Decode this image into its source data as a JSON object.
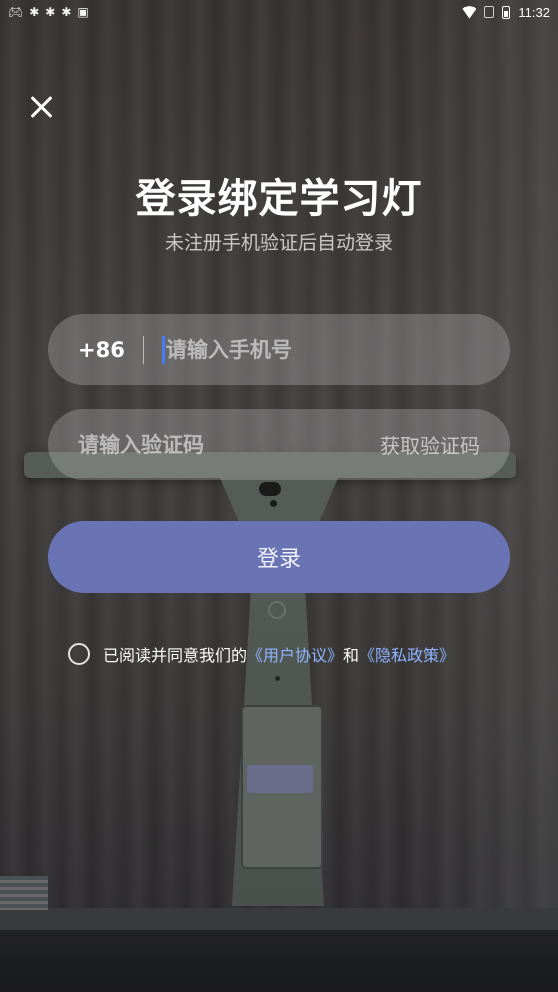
{
  "status_bar": {
    "time": "11:32",
    "left_icons": [
      "gamepad-icon",
      "bug-icon",
      "bug-icon",
      "bug-icon",
      "notification-icon"
    ],
    "right_icons": [
      "wifi-icon",
      "no-sim-icon",
      "battery-icon"
    ]
  },
  "header": {
    "title": "登录绑定学习灯",
    "subtitle": "未注册手机验证后自动登录"
  },
  "phone": {
    "country_code": "+86",
    "placeholder": "请输入手机号",
    "value": ""
  },
  "code": {
    "placeholder": "请输入验证码",
    "value": "",
    "get_code_label": "获取验证码"
  },
  "login_button": {
    "label": "登录"
  },
  "agreement": {
    "prefix": "已阅读并同意我们的",
    "user_agreement": "《用户协议》",
    "conjunction": "和",
    "privacy_policy": "《隐私政策》",
    "checked": false
  },
  "colors": {
    "accent": "#6a74b4",
    "link": "#8fb3ff",
    "caret": "#4a7bff"
  }
}
